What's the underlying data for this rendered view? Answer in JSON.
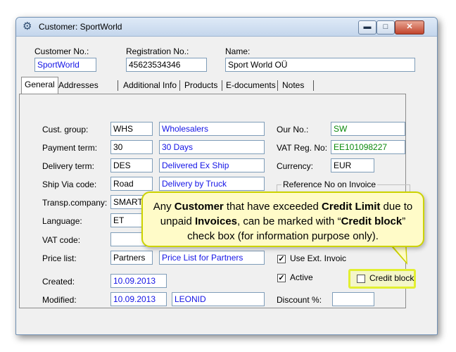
{
  "window": {
    "title": "Customer: SportWorld",
    "min_glyph": "▬",
    "max_glyph": "□",
    "close_glyph": "✕",
    "app_icon": "gear-window-icon"
  },
  "header": {
    "customer_no_label": "Customer No.:",
    "customer_no_value": "SportWorld",
    "registration_no_label": "Registration No.:",
    "registration_no_value": "45623534346",
    "name_label": "Name:",
    "name_value": "Sport World OÜ"
  },
  "tabs": [
    "General",
    "Addresses",
    "Additional Info",
    "Products",
    "E-documents",
    "Notes"
  ],
  "general": {
    "cust_group_label": "Cust. group:",
    "cust_group_code": "WHS",
    "cust_group_desc": "Wholesalers",
    "payment_term_label": "Payment term:",
    "payment_term_code": "30",
    "payment_term_desc": "30 Days",
    "delivery_term_label": "Delivery term:",
    "delivery_term_code": "DES",
    "delivery_term_desc": "Delivered Ex Ship",
    "ship_via_label": "Ship Via code:",
    "ship_via_code": "Road",
    "ship_via_desc": "Delivery by Truck",
    "transp_company_label": "Transp.company:",
    "transp_company_code": "SMART",
    "language_label": "Language:",
    "language_code": "ET",
    "vat_code_label": "VAT code:",
    "vat_code_value": "",
    "price_list_label": "Price list:",
    "price_list_code": "Partners",
    "price_list_desc": "Price List for Partners",
    "created_label": "Created:",
    "created_value": "10.09.2013",
    "modified_label": "Modified:",
    "modified_value": "10.09.2013",
    "modified_by": "LEONID",
    "our_no_label": "Our No.:",
    "our_no_value": "SW",
    "vat_reg_label": "VAT Reg. No:",
    "vat_reg_value": "EE101098227",
    "currency_label": "Currency:",
    "currency_value": "EUR",
    "reference_group_label": "Reference No on Invoice",
    "use_ext_invoice_label": "Use Ext. Invoic",
    "use_ext_invoice_checked": true,
    "active_label": "Active",
    "active_checked": true,
    "credit_block_label": "Credit block",
    "credit_block_checked": false,
    "discount_label": "Discount %:",
    "discount_value": ""
  },
  "callout": {
    "t1": "Any ",
    "b1": "Customer",
    "t2": " that have exceeded ",
    "b2": "Credit Limit",
    "t3": " due to unpaid ",
    "b3": "Invoices",
    "t4": ", can be marked with “",
    "b4": "Credit block",
    "t5": "” check box (for information purpose only)."
  },
  "colors": {
    "callout_bg": "#fffbc8",
    "callout_border": "#ccd300",
    "link_blue": "#1414e6",
    "value_green": "#0b8a0b"
  }
}
